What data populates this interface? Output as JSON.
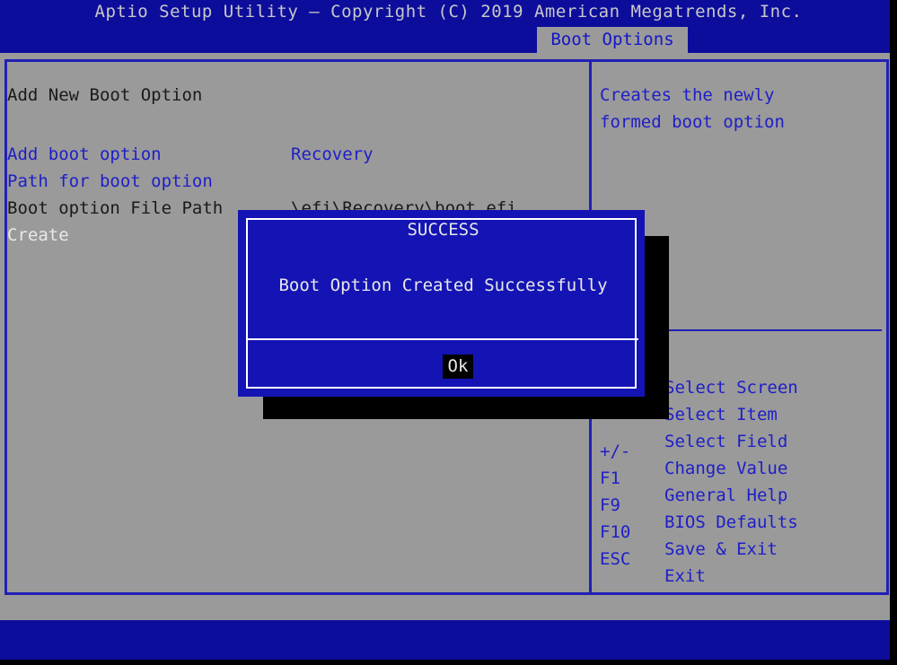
{
  "header": {
    "title": "Aptio Setup Utility – Copyright (C) 2019 American Megatrends, Inc."
  },
  "tabs": [
    {
      "label": "Boot Options",
      "active": true
    }
  ],
  "main": {
    "section_title": "Add New Boot Option",
    "fields": [
      {
        "label": "Add boot option",
        "value": "Recovery",
        "label_style": "blue",
        "value_style": "blue"
      },
      {
        "label": "Path for boot option",
        "value": "",
        "label_style": "blue",
        "value_style": "dark"
      },
      {
        "label": "Boot option File Path",
        "value": "\\efi\\Recovery\\boot.efi",
        "label_style": "dark",
        "value_style": "dark"
      }
    ],
    "action": {
      "label": "Create",
      "selected": true
    }
  },
  "help": {
    "text_lines": [
      "Creates the newly",
      "formed boot option"
    ]
  },
  "key_legend": [
    {
      "key": "",
      "desc": "Select Screen"
    },
    {
      "key": "",
      "desc": "Select Item"
    },
    {
      "key": "",
      "desc": "Select Field"
    },
    {
      "key": "+/-",
      "desc": "Change Value"
    },
    {
      "key": "F1",
      "desc": "General Help"
    },
    {
      "key": "F9",
      "desc": "BIOS Defaults"
    },
    {
      "key": "F10",
      "desc": "Save & Exit"
    },
    {
      "key": "ESC",
      "desc": "Exit"
    }
  ],
  "dialog": {
    "title": "SUCCESS",
    "message": "Boot Option Created Successfully",
    "ok_label": "Ok"
  },
  "colors": {
    "background_blue": "#0d0d9c",
    "panel_gray": "#9a9a9a",
    "border_blue": "#2020b4",
    "text_blue": "#1e1ec8",
    "text_dark": "#1a1a1a",
    "text_white": "#e8e8e8",
    "dialog_blue": "#1414b4",
    "shadow_black": "#000000"
  }
}
